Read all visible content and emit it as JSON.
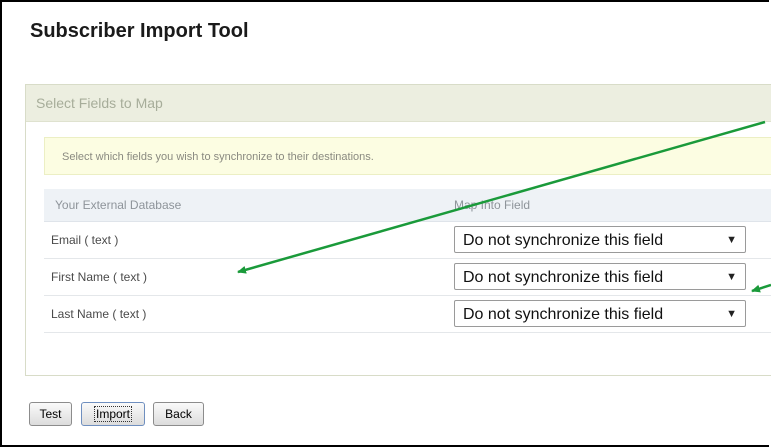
{
  "page": {
    "title": "Subscriber Import Tool"
  },
  "panel": {
    "header": "Select Fields to Map",
    "notice": "Select which fields you wish to synchronize to their destinations."
  },
  "table": {
    "columns": [
      "Your External Database",
      "Map Into Field"
    ],
    "rows": [
      {
        "field": "Email ( text )",
        "mapping": "Do not synchronize this field"
      },
      {
        "field": "First Name ( text )",
        "mapping": "Do not synchronize this field"
      },
      {
        "field": "Last Name ( text )",
        "mapping": "Do not synchronize this field"
      }
    ]
  },
  "buttons": {
    "test": "Test",
    "import": "Import",
    "back": "Back"
  },
  "icons": {
    "dropdown": "chevron-down-icon",
    "annotation": "arrow-icon"
  },
  "colors": {
    "annotation_arrow": "#1a9a3a",
    "panel_header_bg": "#eceee0",
    "notice_bg": "#fcfde2"
  }
}
